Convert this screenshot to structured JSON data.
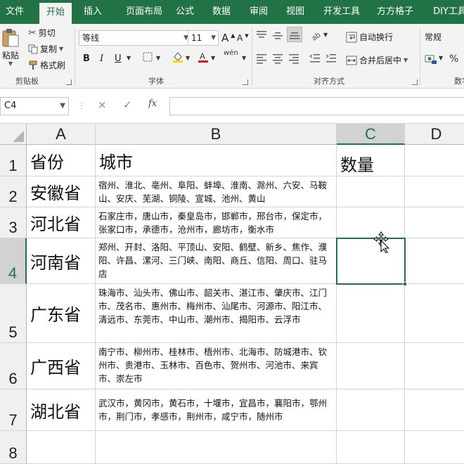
{
  "ribbon_tabs": [
    "文件",
    "开始",
    "插入",
    "页面布局",
    "公式",
    "数据",
    "审阅",
    "视图",
    "开发工具",
    "方方格子",
    "DIY工具"
  ],
  "active_tab": "开始",
  "clipboard": {
    "paste": "粘贴",
    "cut": "剪切",
    "copy": "复制",
    "format_painter": "格式刷",
    "group": "剪贴板"
  },
  "font": {
    "family": "等线",
    "size": "11",
    "bold": "B",
    "italic": "I",
    "underline": "U",
    "phonetic": "wén",
    "group": "字体",
    "grow": "A",
    "shrink": "A"
  },
  "alignment": {
    "wrap_text": "自动换行",
    "merge_center": "合并后居中",
    "group": "对齐方式"
  },
  "number": {
    "format": "常规",
    "percent": "%",
    "group": "数字"
  },
  "formula_bar": {
    "name_box": "C4",
    "cancel_icon": "×",
    "enter_icon": "✓",
    "fx": "fx",
    "content": ""
  },
  "columns": [
    "A",
    "B",
    "C",
    "D"
  ],
  "rows": [
    "1",
    "2",
    "3",
    "4",
    "5",
    "6",
    "7",
    "8"
  ],
  "header": {
    "province": "省份",
    "city": "城市",
    "count": "数量"
  },
  "table": [
    {
      "province": "安徽省",
      "cities": "宿州、淮北、亳州、阜阳、蚌埠、淮南、滁州、六安、马鞍山、安庆、芜湖、铜陵、宣城、池州、黄山"
    },
    {
      "province": "河北省",
      "cities": "石家庄市，唐山市，秦皇岛市，邯郸市，邢台市，保定市，张家口市，承德市，沧州市，廊坊市，衡水市"
    },
    {
      "province": "河南省",
      "cities": "郑州、开封、洛阳、平顶山、安阳、鹤壁、新乡、焦作、濮阳、许昌、漯河、三门峡、南阳、商丘、信阳、周口、驻马店"
    },
    {
      "province": "广东省",
      "cities": "珠海市、汕头市、佛山市、韶关市、湛江市、肇庆市、江门市、茂名市、惠州市、梅州市、汕尾市、河源市、阳江市、清远市、东莞市、中山市、潮州市、揭阳市、云浮市"
    },
    {
      "province": "广西省",
      "cities": "南宁市、柳州市、桂林市、梧州市、北海市、防城港市、钦州市、贵港市、玉林市、百色市、贺州市、河池市、来宾市、崇左市"
    },
    {
      "province": "湖北省",
      "cities": "武汉市，黄冈市，黄石市，十堰市，宜昌市，襄阳市，鄂州市，荆门市，孝感市，荆州市，咸宁市，随州市"
    }
  ],
  "selected_cell": "C4",
  "colors": {
    "accent": "#217346"
  }
}
